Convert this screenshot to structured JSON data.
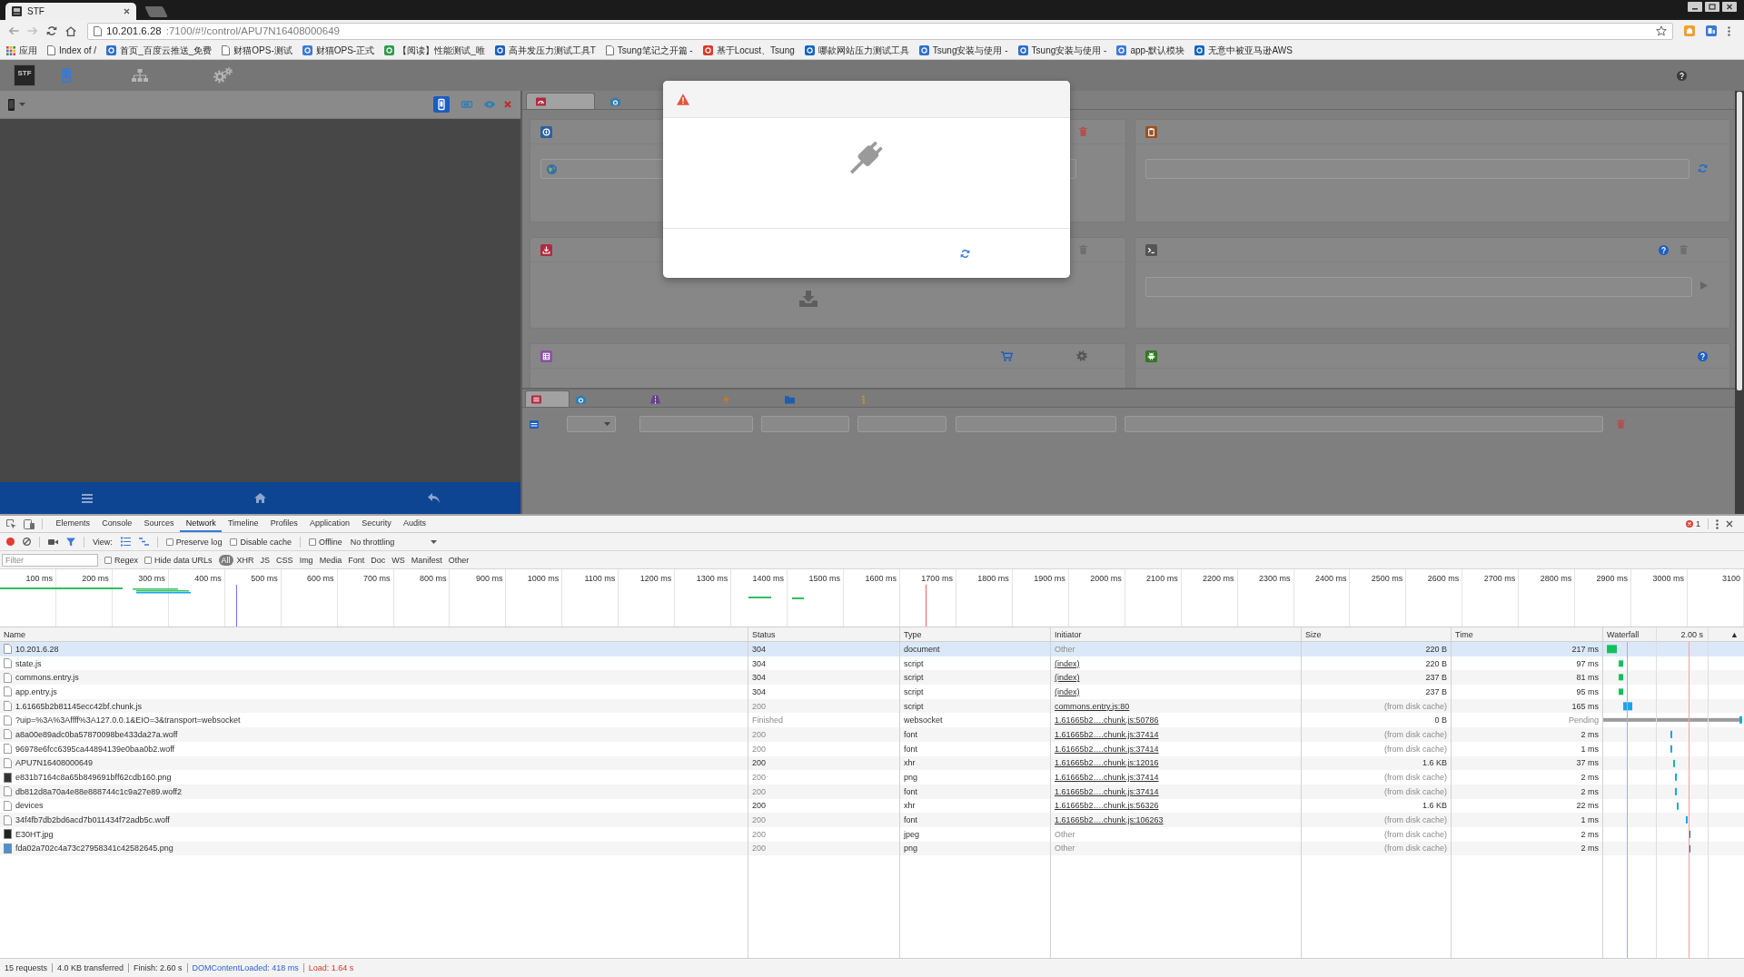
{
  "browser": {
    "tabs": [
      {
        "title": "STF",
        "selected": true
      }
    ],
    "address": {
      "host": "10.201.6.28",
      "path": ":7100/#!/control/APU7N16408000649"
    },
    "bookmarks": [
      {
        "label": "应用",
        "kind": "apps"
      },
      {
        "label": "Index of /",
        "kind": "page"
      },
      {
        "label": "首页_百度云推送_免费",
        "kind": "site",
        "color": "#2f6fc9"
      },
      {
        "label": "财猫OPS-测试",
        "kind": "page"
      },
      {
        "label": "财猫OPS-正式",
        "kind": "site",
        "color": "#3a7bd5"
      },
      {
        "label": "【阅读】性能测试_唯",
        "kind": "site",
        "color": "#2e9b4f"
      },
      {
        "label": "高并发压力测试工具T",
        "kind": "site",
        "color": "#1f5fbf"
      },
      {
        "label": "Tsung笔记之开篇 -",
        "kind": "page"
      },
      {
        "label": "基于Locust、Tsung",
        "kind": "site",
        "color": "#d93a2b"
      },
      {
        "label": "哪款网站压力测试工具",
        "kind": "site",
        "color": "#1565c0"
      },
      {
        "label": "Tsung安装与使用 -",
        "kind": "site",
        "color": "#2f6fc9"
      },
      {
        "label": "Tsung安装与使用 -",
        "kind": "site",
        "color": "#2f6fc9"
      },
      {
        "label": "app-默认模块",
        "kind": "site",
        "color": "#3a7bd5"
      },
      {
        "label": "无意中被亚马逊AWS",
        "kind": "site",
        "color": "#1565c0"
      }
    ]
  },
  "stf": {
    "logo": "STF",
    "nav": [
      {
        "kind": "devices",
        "selected": true
      },
      {
        "kind": "network",
        "selected": false
      },
      {
        "kind": "settings",
        "selected": false
      }
    ],
    "device": {
      "orientation": [
        {
          "kind": "portrait",
          "selected": true
        },
        {
          "kind": "landscape",
          "selected": false
        }
      ],
      "actions": [
        {
          "kind": "view"
        },
        {
          "kind": "close"
        }
      ],
      "buttons": [
        {
          "kind": "menu"
        },
        {
          "kind": "home"
        },
        {
          "kind": "back"
        }
      ]
    },
    "control_tabs": [
      {
        "kind": "dashboard",
        "selected": true
      },
      {
        "kind": "screenshots",
        "selected": false
      }
    ],
    "panels": [
      {
        "kind": "navigation"
      },
      {
        "kind": "clipboard"
      },
      {
        "kind": "upload"
      },
      {
        "kind": "shell"
      },
      {
        "kind": "apps"
      },
      {
        "kind": "debug"
      }
    ],
    "bottom_tabs": [
      {
        "kind": "logs",
        "selected": true
      },
      {
        "kind": "screenshots",
        "selected": false
      },
      {
        "kind": "automation",
        "selected": false
      },
      {
        "kind": "advanced",
        "selected": false
      },
      {
        "kind": "explorer",
        "selected": false
      },
      {
        "kind": "info",
        "selected": false
      }
    ],
    "log_filters": [
      {
        "kind": "select"
      },
      {
        "kind": "text"
      },
      {
        "kind": "text"
      },
      {
        "kind": "text"
      },
      {
        "kind": "text"
      },
      {
        "kind": "text"
      }
    ],
    "dialog": {
      "open": true
    }
  },
  "devtools": {
    "tabs": [
      {
        "label": "Elements",
        "selected": false
      },
      {
        "label": "Console",
        "selected": false
      },
      {
        "label": "Sources",
        "selected": false
      },
      {
        "label": "Network",
        "selected": true
      },
      {
        "label": "Timeline",
        "selected": false
      },
      {
        "label": "Profiles",
        "selected": false
      },
      {
        "label": "Application",
        "selected": false
      },
      {
        "label": "Security",
        "selected": false
      },
      {
        "label": "Audits",
        "selected": false
      }
    ],
    "error_count": "1",
    "toolbar": {
      "recording": true,
      "filter_on": true,
      "view_label": "View:",
      "view_buttons": [
        {
          "kind": "rows",
          "selected": true
        },
        {
          "kind": "overview",
          "selected": true
        }
      ],
      "checkboxes": [
        {
          "label": "Preserve log",
          "checked": false
        },
        {
          "label": "Disable cache",
          "checked": false
        },
        {
          "label": "Offline",
          "checked": false
        }
      ],
      "throttling": "No throttling"
    },
    "filter": {
      "placeholder": "Filter",
      "options": [
        {
          "label": "Regex",
          "checked": false
        },
        {
          "label": "Hide data URLs",
          "checked": false
        }
      ],
      "types": [
        {
          "label": "All",
          "selected": true
        },
        {
          "label": "XHR",
          "selected": false
        },
        {
          "label": "JS",
          "selected": false
        },
        {
          "label": "CSS",
          "selected": false
        },
        {
          "label": "Img",
          "selected": false
        },
        {
          "label": "Media",
          "selected": false
        },
        {
          "label": "Font",
          "selected": false
        },
        {
          "label": "Doc",
          "selected": false
        },
        {
          "label": "WS",
          "selected": false
        },
        {
          "label": "Manifest",
          "selected": false
        },
        {
          "label": "Other",
          "selected": false
        }
      ]
    },
    "overview": {
      "ticks": [
        "100 ms",
        "200 ms",
        "300 ms",
        "400 ms",
        "500 ms",
        "600 ms",
        "700 ms",
        "800 ms",
        "900 ms",
        "1000 ms",
        "1100 ms",
        "1200 ms",
        "1300 ms",
        "1400 ms",
        "1500 ms",
        "1600 ms",
        "1700 ms",
        "1800 ms",
        "1900 ms",
        "2000 ms",
        "2100 ms",
        "2200 ms",
        "2300 ms",
        "2400 ms",
        "2500 ms",
        "2600 ms",
        "2700 ms",
        "2800 ms",
        "2900 ms",
        "3000 ms",
        "3100"
      ]
    },
    "table": {
      "columns": [
        "Name",
        "Status",
        "Type",
        "Initiator",
        "Size",
        "Time",
        "Waterfall"
      ],
      "waterfall_label": "2.00 s",
      "sort_arrow": "▲",
      "rows": [
        {
          "name": "10.201.6.28",
          "kind": "file",
          "status": "304",
          "type": "document",
          "initiator": "Other",
          "initiator_link": false,
          "size": "220 B",
          "time": "217 ms",
          "cached": false,
          "pending": false,
          "selected": true
        },
        {
          "name": "state.js",
          "kind": "file",
          "status": "304",
          "type": "script",
          "initiator": "(index)",
          "initiator_link": true,
          "size": "220 B",
          "time": "97 ms",
          "cached": false,
          "pending": false,
          "selected": false
        },
        {
          "name": "commons.entry.js",
          "kind": "file",
          "status": "304",
          "type": "script",
          "initiator": "(index)",
          "initiator_link": true,
          "size": "237 B",
          "time": "81 ms",
          "cached": false,
          "pending": false,
          "selected": false
        },
        {
          "name": "app.entry.js",
          "kind": "file",
          "status": "304",
          "type": "script",
          "initiator": "(index)",
          "initiator_link": true,
          "size": "237 B",
          "time": "95 ms",
          "cached": false,
          "pending": false,
          "selected": false
        },
        {
          "name": "1.61665b2b81145ecc42bf.chunk.js",
          "kind": "file",
          "status": "200",
          "type": "script",
          "initiator": "commons.entry.js:80",
          "initiator_link": true,
          "size": "(from disk cache)",
          "time": "165 ms",
          "cached": true,
          "pending": false,
          "selected": false
        },
        {
          "name": "?uip=%3A%3Affff%3A127.0.0.1&EIO=3&transport=websocket",
          "kind": "file",
          "status": "Finished",
          "type": "websocket",
          "initiator": "1.61665b2….chunk.js:50786",
          "initiator_link": true,
          "size": "0 B",
          "time": "Pending",
          "cached": false,
          "pending": true,
          "selected": false
        },
        {
          "name": "a8a00e89adc0ba57870098be433da27a.woff",
          "kind": "file",
          "status": "200",
          "type": "font",
          "initiator": "1.61665b2….chunk.js:37414",
          "initiator_link": true,
          "size": "(from disk cache)",
          "time": "2 ms",
          "cached": true,
          "pending": false,
          "selected": false
        },
        {
          "name": "96978e6fcc6395ca44894139e0baa0b2.woff",
          "kind": "file",
          "status": "200",
          "type": "font",
          "initiator": "1.61665b2….chunk.js:37414",
          "initiator_link": true,
          "size": "(from disk cache)",
          "time": "1 ms",
          "cached": true,
          "pending": false,
          "selected": false
        },
        {
          "name": "APU7N16408000649",
          "kind": "file",
          "status": "200",
          "type": "xhr",
          "initiator": "1.61665b2….chunk.js:12016",
          "initiator_link": true,
          "size": "1.6 KB",
          "time": "37 ms",
          "cached": false,
          "pending": false,
          "selected": false
        },
        {
          "name": "e831b7164c8a65b849691bff62cdb160.png",
          "kind": "image",
          "color": "#333333",
          "status": "200",
          "type": "png",
          "initiator": "1.61665b2….chunk.js:37414",
          "initiator_link": true,
          "size": "(from disk cache)",
          "time": "2 ms",
          "cached": true,
          "pending": false,
          "selected": false
        },
        {
          "name": "db812d8a70a4e88e888744c1c9a27e89.woff2",
          "kind": "file",
          "status": "200",
          "type": "font",
          "initiator": "1.61665b2….chunk.js:37414",
          "initiator_link": true,
          "size": "(from disk cache)",
          "time": "2 ms",
          "cached": true,
          "pending": false,
          "selected": false
        },
        {
          "name": "devices",
          "kind": "file",
          "status": "200",
          "type": "xhr",
          "initiator": "1.61665b2….chunk.js:56326",
          "initiator_link": true,
          "size": "1.6 KB",
          "time": "22 ms",
          "cached": false,
          "pending": false,
          "selected": false
        },
        {
          "name": "34f4fb7db2bd6acd7b011434f72adb5c.woff",
          "kind": "file",
          "status": "200",
          "type": "font",
          "initiator": "1.61665b2….chunk.js:106263",
          "initiator_link": true,
          "size": "(from disk cache)",
          "time": "1 ms",
          "cached": true,
          "pending": false,
          "selected": false
        },
        {
          "name": "E30HT.jpg",
          "kind": "image",
          "color": "#222222",
          "status": "200",
          "type": "jpeg",
          "initiator": "Other",
          "initiator_link": false,
          "size": "(from disk cache)",
          "time": "2 ms",
          "cached": true,
          "pending": false,
          "selected": false
        },
        {
          "name": "fda02a702c4a73c27958341c42582645.png",
          "kind": "image",
          "color": "#4a90d9",
          "status": "200",
          "type": "png",
          "initiator": "Other",
          "initiator_link": false,
          "size": "(from disk cache)",
          "time": "2 ms",
          "cached": true,
          "pending": false,
          "selected": false
        }
      ]
    },
    "status_bar": [
      {
        "text": "15 requests",
        "kind": "plain"
      },
      {
        "text": "4.0 KB transferred",
        "kind": "plain"
      },
      {
        "text": "Finish: 2.60 s",
        "kind": "plain"
      },
      {
        "text": "DOMContentLoaded: 418 ms",
        "kind": "dom"
      },
      {
        "text": "Load: 1.64 s",
        "kind": "load"
      }
    ]
  }
}
